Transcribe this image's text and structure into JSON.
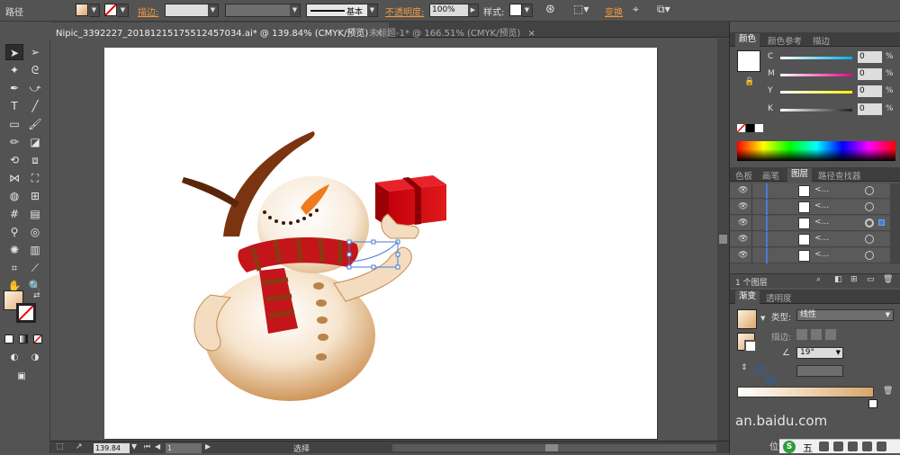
{
  "control_bar": {
    "object_type": "路径",
    "stroke_label": "描边:",
    "stroke_profile": "基本",
    "opacity_label": "不透明度:",
    "opacity_value": "100%",
    "style_label": "样式:",
    "transform_label": "变换"
  },
  "document_tabs": [
    {
      "label": "Nipic_3392227_20181215175512457034.ai* @ 139.84% (CMYK/预览)",
      "active": true
    },
    {
      "label": "未标题-1* @ 166.51% (CMYK/预览)",
      "active": false
    }
  ],
  "status_bar": {
    "zoom": "139.84",
    "page": "1",
    "mode": "选择"
  },
  "color_panel": {
    "tabs": [
      "颜色",
      "颜色参考",
      "描边"
    ],
    "channels": [
      {
        "name": "C",
        "value": "0",
        "unit": "%",
        "color": "#00aeef"
      },
      {
        "name": "M",
        "value": "0",
        "unit": "%",
        "color": "#ec008c"
      },
      {
        "name": "Y",
        "value": "0",
        "unit": "%",
        "color": "#fff200"
      },
      {
        "name": "K",
        "value": "0",
        "unit": "%",
        "color": "#231f20"
      }
    ]
  },
  "layers_panel": {
    "tabs": [
      "色板",
      "画笔",
      "图层",
      "路径查找器"
    ],
    "rows": [
      {
        "name": "<..."
      },
      {
        "name": "<..."
      },
      {
        "name": "<..."
      },
      {
        "name": "<..."
      },
      {
        "name": "<..."
      }
    ],
    "footer": "1 个图层"
  },
  "gradient_panel": {
    "tabs": [
      "渐变",
      "透明度"
    ],
    "type_label": "类型:",
    "type_value": "线性",
    "stroke_label": "描边:",
    "angle_value": "19°"
  },
  "watermark": {
    "text": "an.baidu.com",
    "position_label": "位置"
  },
  "ime": {
    "label": "五"
  },
  "colors": {
    "chrome": "#535353",
    "panel_dark": "#3e3e3e",
    "accent_orange": "#f49a3a",
    "layer_blue": "#4a7bd6"
  }
}
